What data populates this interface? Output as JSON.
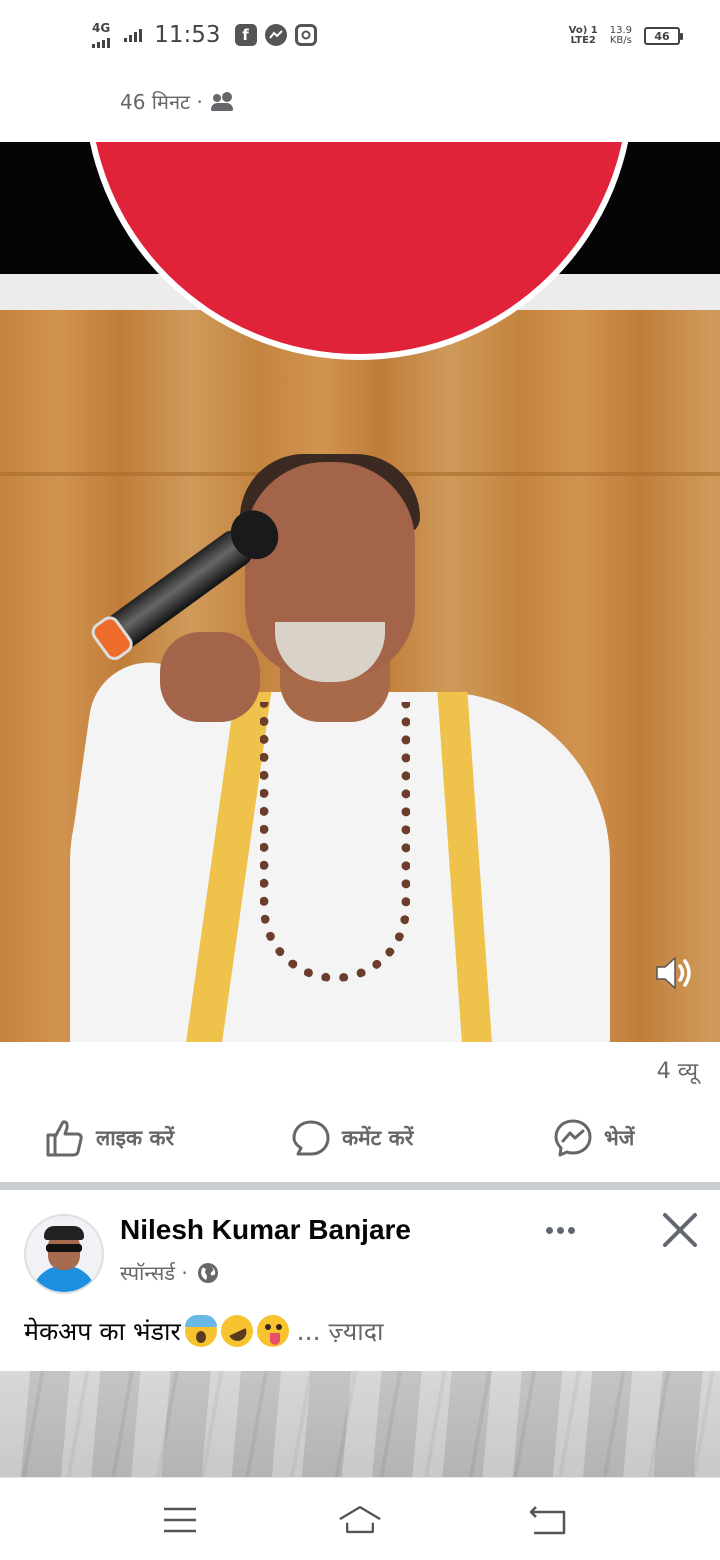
{
  "status_bar": {
    "network": "4G",
    "time": "11:53",
    "volte_top": "Vo) 1",
    "volte_bottom": "LTE2",
    "speed_value": "13.9",
    "speed_unit": "KB/s",
    "battery": "46",
    "app_icons": [
      "facebook-icon",
      "messenger-icon",
      "instagram-icon"
    ]
  },
  "post": {
    "time": "46 मिनट ·",
    "audience_icon": "friends-icon",
    "views": "4 व्यू",
    "volume_icon": "speaker-icon"
  },
  "actions": {
    "like": "लाइक करें",
    "comment": "कमेंट करें",
    "send": "भेजें"
  },
  "sponsored_post": {
    "author": "Nilesh Kumar Banjare",
    "sponsored_label": "स्पॉन्सर्ड ·",
    "audience_icon": "globe-icon",
    "text": "मेकअप का भंडार",
    "emojis": [
      "face-screaming-emoji",
      "rolling-on-floor-laughing-emoji",
      "winking-tongue-emoji"
    ],
    "see_more": "... ज़्यादा"
  },
  "nav_bar": {
    "icons": [
      "menu-icon",
      "home-icon",
      "back-icon"
    ]
  },
  "colors": {
    "text_secondary": "#65676b",
    "divider": "#c9ccd1",
    "logo_red": "#e1233a"
  }
}
